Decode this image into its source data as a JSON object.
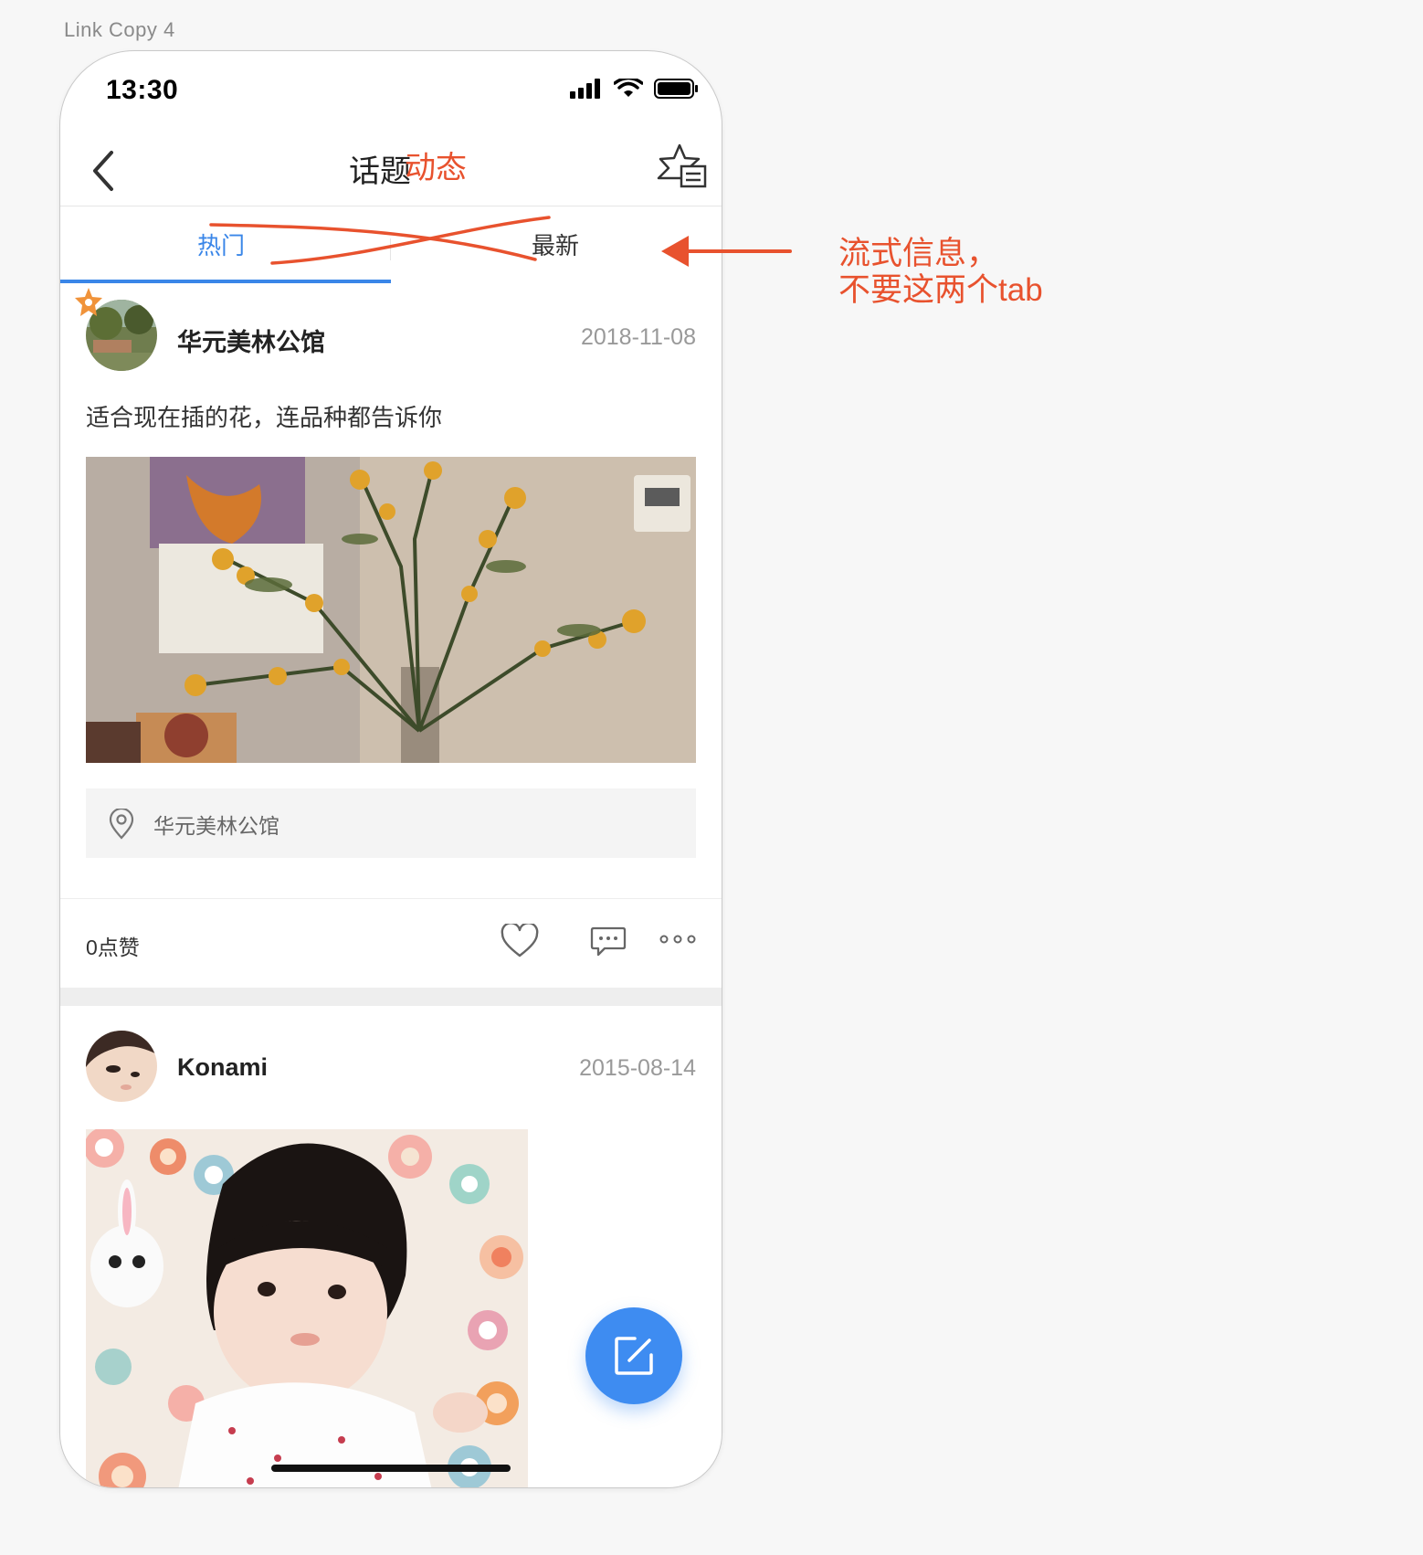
{
  "artboard": {
    "label": "Link Copy 4"
  },
  "status_bar": {
    "time": "13:30"
  },
  "nav": {
    "title_original": "话题",
    "title_annotation": "动态"
  },
  "tabs": [
    {
      "label": "热门",
      "active": true
    },
    {
      "label": "最新",
      "active": false
    }
  ],
  "posts": [
    {
      "user": "华元美林公馆",
      "date": "2018-11-08",
      "text": "适合现在插的花，连品种都告诉你",
      "location": "华元美林公馆",
      "likes": "0点赞"
    },
    {
      "user": "Konami",
      "date": "2015-08-14"
    }
  ],
  "annotation": {
    "line1": "流式信息，",
    "line2": "不要这两个tab"
  },
  "colors": {
    "accent": "#3a86e8",
    "annotation": "#e8522e",
    "fab": "#3e8cf1"
  },
  "icons": [
    "chevron-left-icon",
    "star-list-icon",
    "location-pin-icon",
    "heart-icon",
    "comment-icon",
    "more-icon",
    "edit-icon",
    "signal-icon",
    "wifi-icon",
    "battery-icon"
  ]
}
